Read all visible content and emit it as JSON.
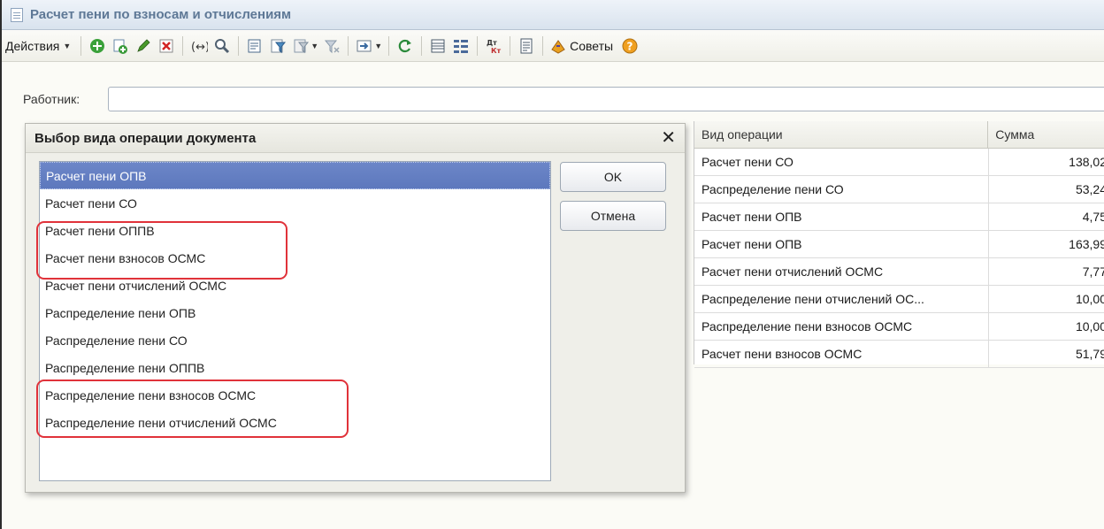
{
  "window": {
    "title": "Расчет пени по взносам и отчислениям"
  },
  "toolbar": {
    "actions_label": "Действия",
    "tips_label": "Советы",
    "buttons": [
      {
        "icon": "add-icon",
        "color": "#3aa13a"
      },
      {
        "icon": "copy-icon",
        "color": "#3a8a3a"
      },
      {
        "icon": "edit-icon",
        "color": "#3a7d2a"
      },
      {
        "icon": "delete-icon",
        "color": "#d22424"
      },
      {
        "icon": "expand-icon",
        "color": "#333333"
      },
      {
        "icon": "search-icon",
        "color": "#506070"
      },
      {
        "icon": "select-icon",
        "color": "#4a6a8a"
      },
      {
        "icon": "filter-icon",
        "color": "#4a6a8a"
      },
      {
        "icon": "filter-list-icon",
        "color": "#4a6a8a"
      },
      {
        "icon": "filter-clear-icon",
        "color": "#8a9aaa"
      },
      {
        "icon": "move-icon",
        "color": "#3a6aa0"
      },
      {
        "icon": "refresh-icon",
        "color": "#2a8a3a"
      },
      {
        "icon": "list-icon",
        "color": "#5a6a7a"
      },
      {
        "icon": "tree-icon",
        "color": "#4a6a9a"
      },
      {
        "icon": "dt-kt-icon",
        "color": "#c03030"
      },
      {
        "icon": "report-icon",
        "color": "#4a5a6a"
      },
      {
        "icon": "tips-icon",
        "color": "#e8a020"
      },
      {
        "icon": "help-icon",
        "color": "#f0a020"
      }
    ]
  },
  "form": {
    "worker_label": "Работник:",
    "worker_value": ""
  },
  "grid": {
    "columns": [
      "Вид операции",
      "Сумма"
    ],
    "rows": [
      {
        "operation": "Расчет пени СО",
        "amount": "138,02"
      },
      {
        "operation": "Распределение пени СО",
        "amount": "53,24"
      },
      {
        "operation": "Расчет пени ОПВ",
        "amount": "4,75"
      },
      {
        "operation": "Расчет пени ОПВ",
        "amount": "163,99"
      },
      {
        "operation": "Расчет пени отчислений ОСМС",
        "amount": "7,77"
      },
      {
        "operation": "Распределение пени отчислений ОС...",
        "amount": "10,00"
      },
      {
        "operation": "Распределение пени взносов ОСМС",
        "amount": "10,00"
      },
      {
        "operation": "Расчет пени взносов ОСМС",
        "amount": "51,79"
      }
    ]
  },
  "dialog": {
    "title": "Выбор вида операции документа",
    "close_glyph": "✕",
    "ok_label": "OK",
    "cancel_label": "Отмена",
    "items": [
      {
        "label": "Расчет пени ОПВ",
        "selected": true
      },
      {
        "label": "Расчет пени СО",
        "selected": false
      },
      {
        "label": "Расчет пени ОППВ",
        "selected": false
      },
      {
        "label": "Расчет пени взносов ОСМС",
        "selected": false
      },
      {
        "label": "Расчет пени отчислений ОСМС",
        "selected": false
      },
      {
        "label": "Распределение пени ОПВ",
        "selected": false
      },
      {
        "label": "Распределение пени СО",
        "selected": false
      },
      {
        "label": "Распределение пени ОППВ",
        "selected": false
      },
      {
        "label": "Распределение пени взносов ОСМС",
        "selected": false
      },
      {
        "label": "Распределение пени отчислений ОСМС",
        "selected": false
      }
    ],
    "highlight_color": "#e0323a"
  }
}
